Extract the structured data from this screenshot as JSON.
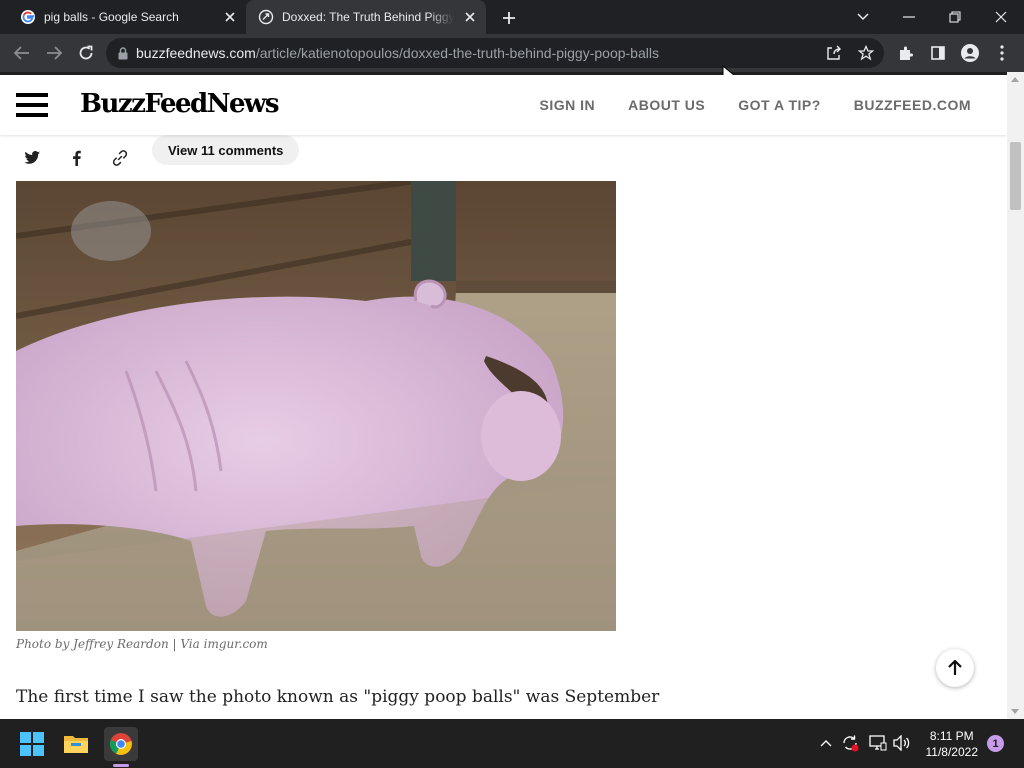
{
  "browser": {
    "tabs": [
      {
        "title": "pig balls - Google Search",
        "favicon": "google-g-icon",
        "active": false
      },
      {
        "title": "Doxxed: The Truth Behind Piggy P",
        "favicon": "buzzfeed-icon",
        "active": true
      }
    ],
    "url_host": "buzzfeednews.com",
    "url_path": "/article/katienotopoulos/doxxed-the-truth-behind-piggy-poop-balls"
  },
  "site": {
    "logo_part1": "BuzzFeed",
    "logo_part2": "News",
    "nav": [
      "SIGN IN",
      "ABOUT US",
      "GOT A TIP?",
      "BUZZFEED.COM"
    ]
  },
  "article": {
    "comments_label": "View 11 comments",
    "photo_alt": "Photo of a pig in a wooden pen",
    "photo_caption": "Photo by Jeffrey Reardon | Via imgur.com",
    "body_first_line": "The first time I saw the photo known as \"piggy poop balls\" was September"
  },
  "taskbar": {
    "time": "8:11 PM",
    "date": "11/8/2022",
    "notification_count": "1"
  },
  "colors": {
    "tabstrip": "#202124",
    "toolbar": "#35363a",
    "buzzfeed_red": "#e32",
    "taskbar": "#202020",
    "accent": "#c69be8"
  }
}
